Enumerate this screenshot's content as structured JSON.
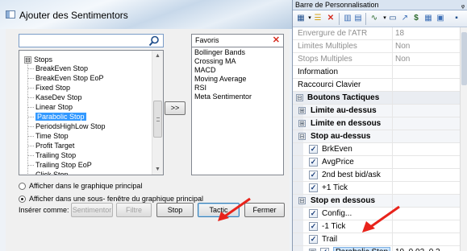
{
  "dialog": {
    "title": "Ajouter des Sentimentors",
    "search": {
      "value": "",
      "placeholder": ""
    },
    "tree": {
      "root": "Stops",
      "root_toggle": "⊟",
      "items": [
        "BreakEven Stop",
        "BreakEven Stop EoP",
        "Fixed Stop",
        "KaseDev Stop",
        "Linear Stop",
        "Parabolic Stop",
        "PeriodsHighLow Stop",
        "Time Stop",
        "Profit Target",
        "Trailing Stop",
        "Trailing Stop EoP",
        "Click Stop"
      ],
      "selected_index": 5
    },
    "move_button": ">>",
    "favorites": {
      "header": "Favoris",
      "close": "✕",
      "items": [
        "Bollinger Bands",
        "Crossing MA",
        "MACD",
        "Moving Average",
        "RSI",
        "Meta Sentimentor"
      ]
    },
    "radios": [
      {
        "label": "Afficher dans le graphique principal",
        "checked": false
      },
      {
        "label": "Afficher dans une sous- fenêtre du graphique principal",
        "checked": true
      }
    ],
    "insert_label": "Insérer comme:",
    "buttons": {
      "sentimentor": "Sentimentor",
      "filtre": "Filtre",
      "stop": "Stop",
      "tactic": "Tactic",
      "fermer": "Fermer"
    }
  },
  "panel": {
    "title": "Barre de Personnalisation",
    "pin": "ᵩ",
    "rows": [
      {
        "name": "Envergure de l'ATR",
        "value": "18",
        "style": "dim"
      },
      {
        "name": "Limites Multiples",
        "value": "Non",
        "style": "dim"
      },
      {
        "name": "Stops Multiples",
        "value": "Non",
        "style": "dim"
      },
      {
        "name": "Information",
        "value": "",
        "style": "plain"
      },
      {
        "name": "Raccourci Clavier",
        "value": "",
        "style": "plain"
      },
      {
        "name": "Boutons Tactiques",
        "value": "",
        "style": "cat",
        "toggle": "⊟"
      },
      {
        "name": "Limite au-dessus",
        "value": "",
        "style": "sub",
        "toggle": "⊞"
      },
      {
        "name": "Limite en dessous",
        "value": "",
        "style": "sub",
        "toggle": "⊞"
      },
      {
        "name": "Stop au-dessus",
        "value": "",
        "style": "sub",
        "toggle": "⊟"
      },
      {
        "name": "BrkEven",
        "value": "",
        "style": "check"
      },
      {
        "name": "AvgPrice",
        "value": "",
        "style": "check"
      },
      {
        "name": "2nd best bid/ask",
        "value": "",
        "style": "check"
      },
      {
        "name": "+1 Tick",
        "value": "",
        "style": "check"
      },
      {
        "name": "Stop en dessous",
        "value": "",
        "style": "sub",
        "toggle": "⊟"
      },
      {
        "name": "Config...",
        "value": "",
        "style": "check"
      },
      {
        "name": "-1 Tick",
        "value": "",
        "style": "check"
      },
      {
        "name": "Trail",
        "value": "",
        "style": "check"
      },
      {
        "name": "Parabolic Stop",
        "value": "10, 0.02, 0.2",
        "style": "check-sel",
        "toggle": "⊞"
      }
    ],
    "check_mark": "✓"
  },
  "colors": {
    "accent": "#3399ff",
    "arrow": "#e8231b",
    "panel_header": "#d9e4f1"
  }
}
